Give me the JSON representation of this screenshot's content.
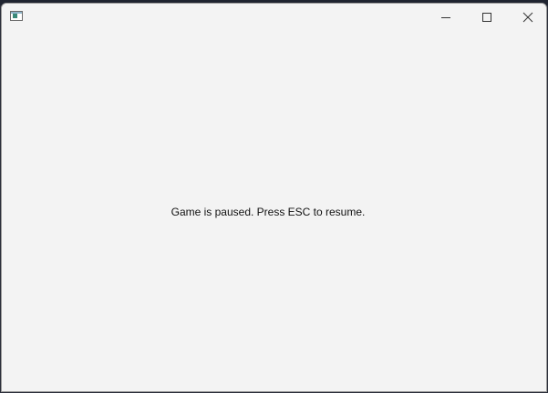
{
  "window": {
    "title": "",
    "icon": "window-app-icon",
    "controls": {
      "minimize": "minimize-icon",
      "maximize": "maximize-icon",
      "close": "close-icon"
    }
  },
  "content": {
    "message": "Game is paused. Press ESC to resume."
  },
  "colors": {
    "window_bg": "#f3f3f3",
    "text": "#111111"
  }
}
